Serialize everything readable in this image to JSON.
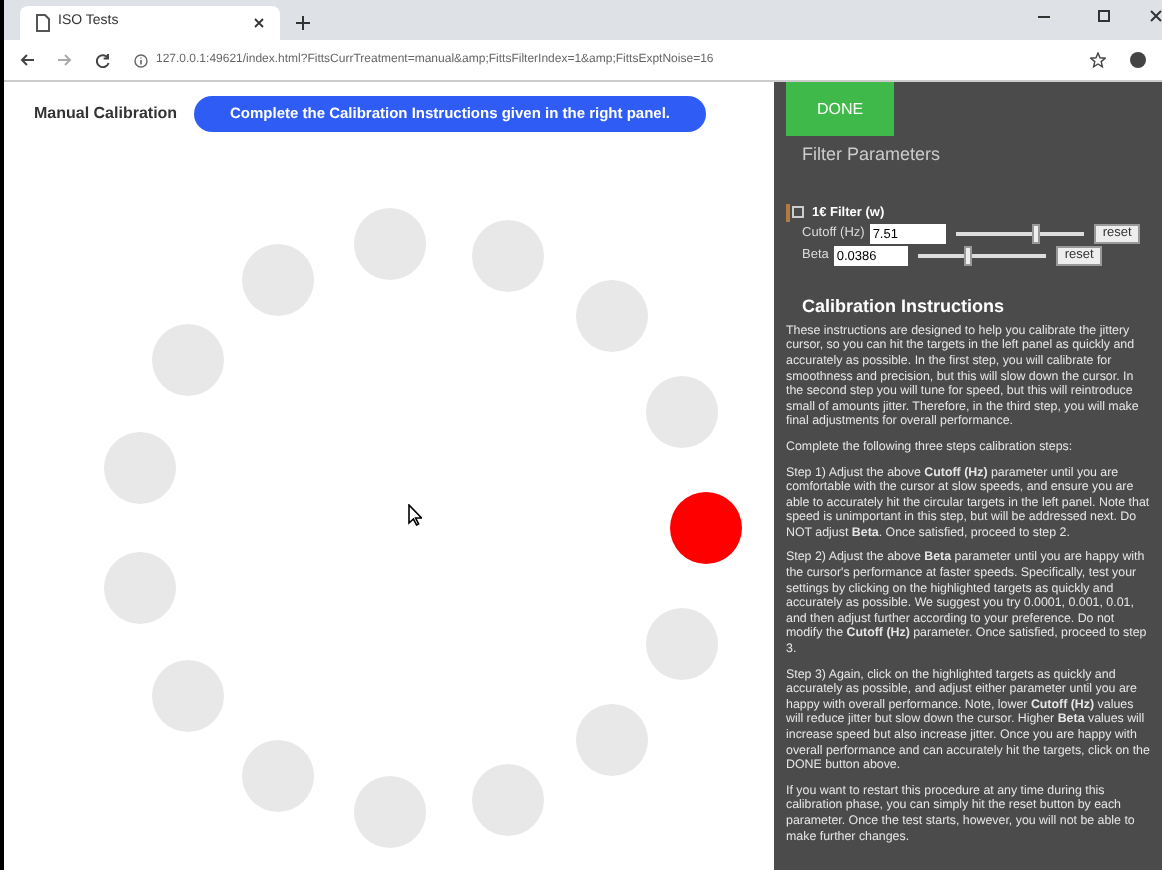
{
  "browser": {
    "tab_title": "ISO Tests",
    "url": "127.0.0.1:49621/index.html?FittsCurrTreatment=manual&amp;FittsFilterIndex=1&amp;FittsExptNoise=16"
  },
  "left_panel": {
    "title": "Manual Calibration",
    "banner": "Complete the Calibration Instructions given in the right panel.",
    "targets": [
      {
        "highlighted": true
      },
      {
        "highlighted": false
      },
      {
        "highlighted": false
      },
      {
        "highlighted": false
      },
      {
        "highlighted": false
      },
      {
        "highlighted": false
      },
      {
        "highlighted": false
      },
      {
        "highlighted": false
      },
      {
        "highlighted": false
      },
      {
        "highlighted": false
      },
      {
        "highlighted": false
      },
      {
        "highlighted": false
      },
      {
        "highlighted": false
      },
      {
        "highlighted": false
      },
      {
        "highlighted": false
      }
    ]
  },
  "right_panel": {
    "done_button": "DONE",
    "section_title": "Filter Parameters",
    "filter": {
      "label": "1€ Filter (w)",
      "checked": false
    },
    "parameters": [
      {
        "label": "Cutoff (Hz)",
        "value": "7.51",
        "level": 0.62,
        "reset": "reset"
      },
      {
        "label": "Beta",
        "value": "0.0386",
        "level": 0.38,
        "reset": "reset"
      }
    ],
    "instructions_title": "Calibration Instructions",
    "paragraphs": [
      "These instructions are designed to help you calibrate the jittery cursor, so you can hit the targets in the left panel as quickly and accurately as possible. In the first step, you will calibrate for smoothness and precision, but this will slow down the cursor. In the second step you will tune for speed, but this will reintroduce small of amounts jitter. Therefore, in the third step, you will make final adjustments for overall performance.",
      "Complete the following three steps calibration steps:",
      "Step 1) Adjust the above **Cutoff (Hz)** parameter until you are comfortable with the cursor at slow speeds, and ensure you are able to accurately hit the circular targets in the left panel. Note that speed is unimportant in this step, but will be addressed next. Do NOT adjust **Beta**. Once satisfied, proceed to step 2.",
      "Step 2) Adjust the above **Beta** parameter until you are happy with the cursor's performance at faster speeds. Specifically, test your settings by clicking on the highlighted targets as quickly and accurately as possible. We suggest you try 0.0001, 0.001, 0.01, and then adjust further according to your preference. Do not modify the **Cutoff (Hz)** parameter. Once satisfied, proceed to step 3.",
      "Step 3) Again, click on the highlighted targets as quickly and accurately as possible, and adjust either parameter until you are happy with overall performance. Note, lower **Cutoff (Hz)** values will reduce jitter but slow down the cursor. Higher **Beta** values will increase speed but also increase jitter. Once you are happy with overall performance and can accurately hit the targets, click on the DONE button above.",
      "If you want to restart this procedure at any time during this calibration phase, you can simply hit the reset button by each parameter. Once the test starts, however, you will not be able to make further changes."
    ]
  }
}
